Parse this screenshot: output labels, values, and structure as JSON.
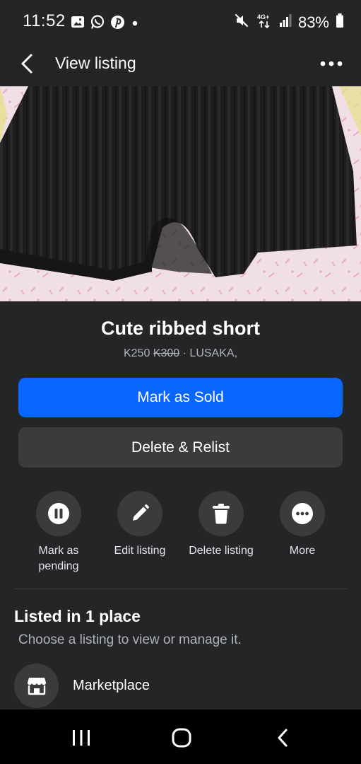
{
  "status_bar": {
    "time": "11:52",
    "network": "4G+",
    "battery": "83%",
    "icons_left": [
      "gallery-icon",
      "whatsapp-icon",
      "pinterest-icon",
      "dot-icon"
    ],
    "icons_right": [
      "mute-icon",
      "network-icon",
      "signal-icon",
      "battery-icon"
    ]
  },
  "app_bar": {
    "title": "View listing",
    "back_icon": "chevron-left-icon",
    "menu_icon": "more-horizontal-icon"
  },
  "listing": {
    "title": "Cute ribbed short",
    "price": "K250",
    "original_price": "K300",
    "separator": "·",
    "location": "LUSAKA,"
  },
  "buttons": {
    "mark_sold": "Mark as Sold",
    "delete_relist": "Delete & Relist"
  },
  "actions": [
    {
      "label": "Mark as\npending",
      "icon": "pause-icon"
    },
    {
      "label": "Edit listing",
      "icon": "pencil-icon"
    },
    {
      "label": "Delete listing",
      "icon": "trash-icon"
    },
    {
      "label": "More",
      "icon": "more-icon"
    }
  ],
  "listed_section": {
    "title": "Listed in 1 place",
    "subtitle": "Choose a listing to view or manage it.",
    "places": [
      {
        "label": "Marketplace",
        "icon": "marketplace-store-icon"
      }
    ]
  },
  "nav_bar": {
    "icons": [
      "recents-icon",
      "home-icon",
      "back-icon"
    ]
  },
  "colors": {
    "background": "#242526",
    "primary": "#0866ff",
    "secondary_button": "#3a3b3c",
    "nav_bar": "#000000"
  }
}
